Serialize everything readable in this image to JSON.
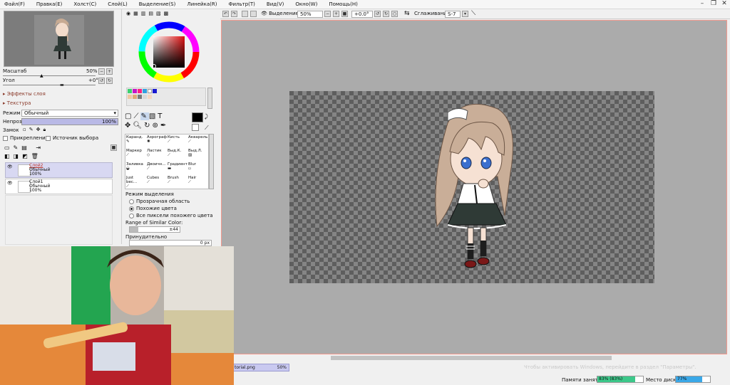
{
  "menu": [
    "Файл(F)",
    "Правка(E)",
    "Холст(C)",
    "Слой(L)",
    "Выделение(S)",
    "Линейка(R)",
    "Фильтр(T)",
    "Вид(V)",
    "Окно(W)",
    "Помощь(H)"
  ],
  "navigator": {
    "scale_label": "Масштаб",
    "scale_value": "50%",
    "angle_label": "Угол",
    "angle_value": "+0°"
  },
  "layer_panel": {
    "effects_label": "Эффекты слоя",
    "texture_label": "Текстура",
    "mode_label": "Режим",
    "mode_value": "Обычный",
    "opacity_label": "Непроз.",
    "opacity_value": "100%",
    "lock_label": "Замок",
    "clip_label": "Прикрепление",
    "source_label": "Источник выбора",
    "layers": [
      {
        "name": "Слой2",
        "mode": "Обычный",
        "opacity": "100%"
      },
      {
        "name": "Слой1",
        "mode": "Обычный",
        "opacity": "100%"
      }
    ]
  },
  "brushes": [
    {
      "label": "Каранд."
    },
    {
      "label": "Аэрограф"
    },
    {
      "label": "Кисть"
    },
    {
      "label": "Акварель"
    },
    {
      "label": "Маркер"
    },
    {
      "label": "Ластик"
    },
    {
      "label": "Выд.К."
    },
    {
      "label": "Выд.Л."
    },
    {
      "label": "Заливка"
    },
    {
      "label": "Двоичн..."
    },
    {
      "label": "Градиент"
    },
    {
      "label": "Blur"
    },
    {
      "label": "Just bec..."
    },
    {
      "label": "Cubes"
    },
    {
      "label": "Brush"
    },
    {
      "label": "Hair"
    }
  ],
  "selection_mode": {
    "title": "Режим выделения",
    "options": [
      "Прозрачная область",
      "Похожие цвета",
      "Все пиксели похожего цвета"
    ],
    "selected": 1,
    "range_label": "Range of Similar Color:",
    "range_value": "±44",
    "force_label": "Принудительно",
    "force_value": "0 px"
  },
  "canvas_toolbar": {
    "selection_label": "Выделение",
    "zoom": "50%",
    "angle": "+0.0°",
    "smoothing_label": "Сглаживание",
    "smoothing_value": "S-7"
  },
  "tab": {
    "filename": "torial.png",
    "zoom": "50%"
  },
  "status": {
    "memory_label": "Памяти занято",
    "memory_value": "83% (83%)",
    "memory_fraction": 0.83,
    "disk_label": "Место диска",
    "disk_value": "77%",
    "disk_fraction": 0.77
  },
  "watermark": "Чтобы активировать Windows, перейдите в раздел \"Параметры\".",
  "colors": {
    "accent": "#e5482f",
    "selected_layer": "#d8d8f2",
    "memory_bar": "#3cc88a",
    "disk_bar": "#3aa8e8",
    "canvas_bg": "#ababab"
  }
}
